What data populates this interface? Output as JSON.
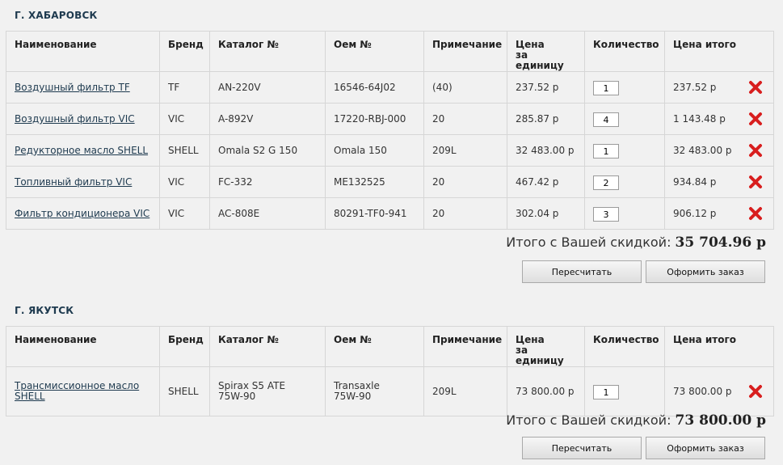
{
  "headers": {
    "name": "Наименование",
    "brand": "Бренд",
    "catalog": "Каталог №",
    "oem": "Оем №",
    "note": "Примечание",
    "price_line1": "Цена",
    "price_line2": "за единицу",
    "qty": "Количество",
    "total": "Цена итого"
  },
  "summary_label": "Итого с Вашей скидкой:",
  "buttons": {
    "recalc": "Пересчитать",
    "order": "Оформить заказ"
  },
  "sections": [
    {
      "city": "Г. ХАБАРОВСК",
      "total": "35 704.96 р",
      "rows": [
        {
          "name": "Воздушный фильтр TF",
          "brand": "TF",
          "catalog": "AN-220V",
          "oem": "16546-64J02",
          "note": "(40)",
          "price": "237.52 р",
          "qty": "1",
          "total": "237.52 р"
        },
        {
          "name": "Воздушный фильтр VIC",
          "brand": "VIC",
          "catalog": "A-892V",
          "oem": "17220-RBJ-000",
          "note": "20",
          "price": "285.87 р",
          "qty": "4",
          "total": "1 143.48 р"
        },
        {
          "name": "Редукторное масло SHELL",
          "brand": "SHELL",
          "catalog": "Omala S2 G 150",
          "oem": "Omala 150",
          "note": "209L",
          "price": "32 483.00 р",
          "qty": "1",
          "total": "32 483.00 р"
        },
        {
          "name": "Топливный фильтр VIC",
          "brand": "VIC",
          "catalog": "FC-332",
          "oem": "ME132525",
          "note": "20",
          "price": "467.42 р",
          "qty": "2",
          "total": "934.84 р"
        },
        {
          "name": "Фильтр кондиционера VIC",
          "brand": "VIC",
          "catalog": "AC-808E",
          "oem": "80291-TF0-941",
          "note": "20",
          "price": "302.04 р",
          "qty": "3",
          "total": "906.12 р"
        }
      ]
    },
    {
      "city": "Г. ЯКУТСК",
      "total": "73 800.00 р",
      "rows": [
        {
          "name_line1": "Трансмиссионное масло",
          "name_line2": "SHELL",
          "brand": "SHELL",
          "catalog_line1": "Spirax S5 ATE",
          "catalog_line2": "75W-90",
          "oem_line1": "Transaxle",
          "oem_line2": "75W-90",
          "note": "209L",
          "price": "73 800.00 р",
          "qty": "1",
          "total": "73 800.00 р"
        }
      ]
    }
  ]
}
